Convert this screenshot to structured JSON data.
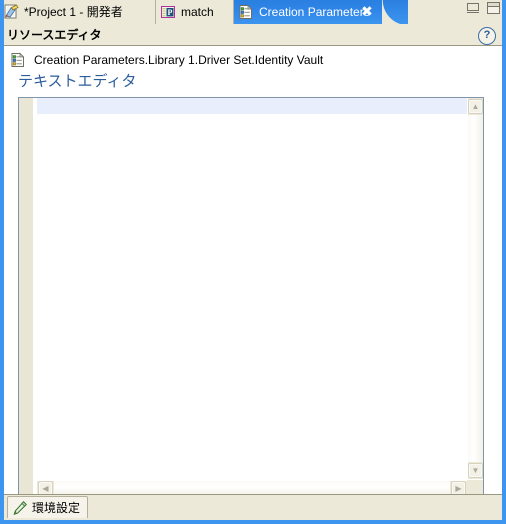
{
  "window": {
    "controls": {
      "minimize": "minimize",
      "maximize": "maximize"
    }
  },
  "tabs": [
    {
      "label": "*Project 1 - 開発者",
      "icon": "project-document-icon",
      "active": false,
      "closable": false
    },
    {
      "label": "match",
      "icon": "policy-icon",
      "active": false,
      "closable": false
    },
    {
      "label": "Creation Parameters",
      "icon": "parameters-list-icon",
      "active": true,
      "closable": true,
      "close_glyph": "✖"
    }
  ],
  "section": {
    "title": "リソースエディタ",
    "help_glyph": "?"
  },
  "form": {
    "breadcrumb": {
      "icon": "parameters-list-icon",
      "text": "Creation Parameters.Library 1.Driver Set.Identity Vault"
    },
    "editor_heading": "テキストエディタ",
    "editor_value": "",
    "editor_placeholder": ""
  },
  "scrollbars": {
    "vertical": {
      "up_glyph": "▲",
      "down_glyph": "▼"
    },
    "horizontal": {
      "left_glyph": "◀",
      "right_glyph": "▶"
    }
  },
  "bottom": {
    "pref_tab_label": "環境設定",
    "pref_tab_icon": "pencil-icon"
  },
  "colors": {
    "accent_blue": "#3d95ef",
    "active_tab_bg": "#2f86e8",
    "chrome_beige": "#ece9d8",
    "heading_blue": "#2c5d9b",
    "current_line": "#e8eefb",
    "gutter": "#e9e6d5"
  }
}
